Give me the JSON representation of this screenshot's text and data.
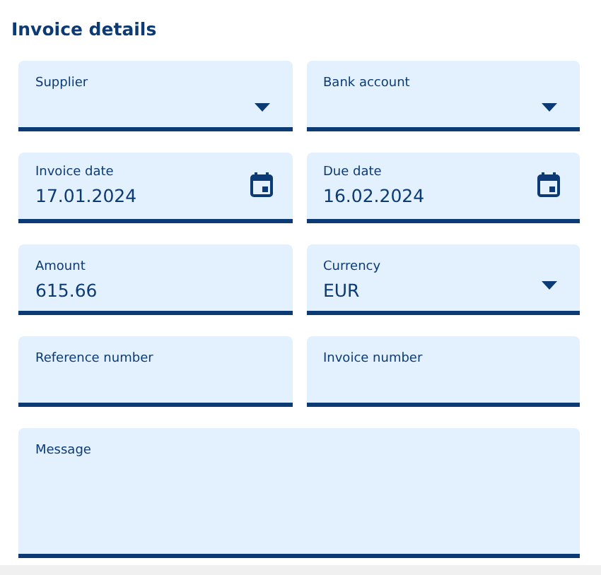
{
  "title": "Invoice details",
  "fields": [
    {
      "kind": "select",
      "label": "Supplier"
    },
    {
      "kind": "select",
      "label": "Bank account"
    },
    {
      "kind": "date",
      "label": "Invoice date",
      "value": "17.01.2024"
    },
    {
      "kind": "date",
      "label": "Due date",
      "value": "16.02.2024"
    },
    {
      "kind": "text",
      "label": "Amount",
      "value": "615.66"
    },
    {
      "kind": "select",
      "label": "Currency",
      "value": "EUR"
    },
    {
      "kind": "text",
      "label": "Reference number"
    },
    {
      "kind": "text",
      "label": "Invoice number"
    },
    {
      "kind": "textarea",
      "label": "Message"
    }
  ]
}
